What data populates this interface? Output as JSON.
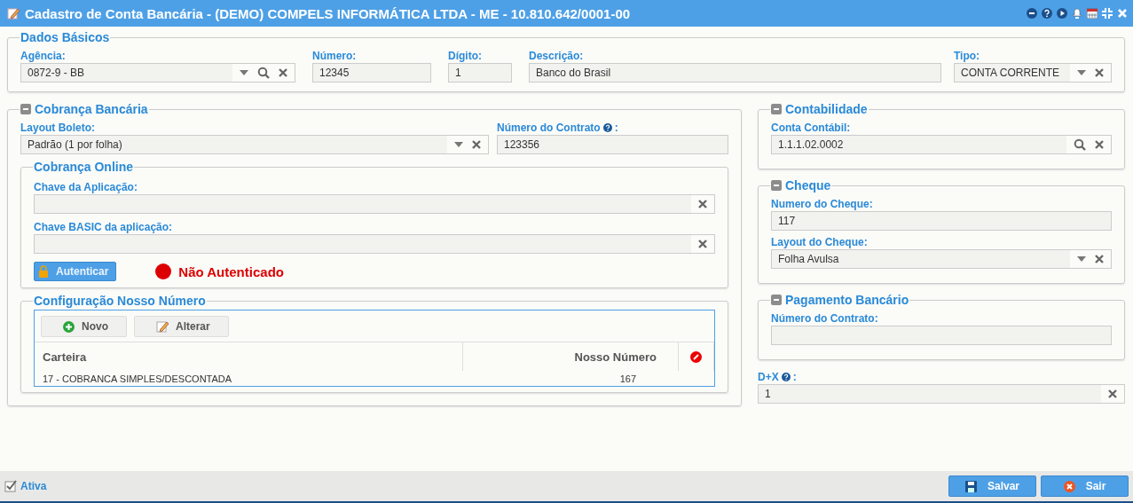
{
  "window": {
    "title": "Cadastro de Conta Bancária - (DEMO) COMPELS INFORMÁTICA LTDA - ME - 10.810.642/0001-00"
  },
  "dados_basicos": {
    "title": "Dados Básicos",
    "fields": [
      {
        "label": "Agência:",
        "value": "0872-9 - BB",
        "kind": "combo_search"
      },
      {
        "label": "Número:",
        "value": "12345",
        "kind": "plain"
      },
      {
        "label": "Dígito:",
        "value": "1",
        "kind": "plain"
      },
      {
        "label": "Descrição:",
        "value": "Banco do Brasil",
        "kind": "plain"
      },
      {
        "label": "Tipo:",
        "value": "CONTA CORRENTE",
        "kind": "combo"
      }
    ]
  },
  "cobranca_bancaria": {
    "title": "Cobrança Bancária",
    "expanded": true,
    "fields": [
      {
        "label": "Layout Boleto:",
        "value": "Padrão (1 por folha)",
        "kind": "combo"
      },
      {
        "label": "Número do Contrato",
        "suffix": ":",
        "value": "123356",
        "kind": "plain",
        "help": true
      }
    ],
    "cobranca_online": {
      "title": "Cobrança Online",
      "fields": [
        {
          "label": "Chave da Aplicação:",
          "kind": "clear"
        },
        {
          "label": "Chave BASIC da aplicação:",
          "kind": "clear"
        }
      ],
      "button": "Autenticar",
      "authenticated": false,
      "status": "Não Autenticado"
    },
    "nosso_numero": {
      "title": "Configuração Nosso Número",
      "toolbar": [
        {
          "label": "Novo",
          "kind": "add"
        },
        {
          "label": "Alterar",
          "kind": "edit"
        }
      ],
      "columns": [
        "Carteira",
        "Nosso Número"
      ],
      "rows": [
        [
          "17 - COBRANCA SIMPLES/DESCONTADA",
          "167"
        ]
      ]
    }
  },
  "contabilidade": {
    "title": "Contabilidade",
    "expanded": true,
    "fields": [
      {
        "label": "Conta Contábil:",
        "value": "1.1.1.02.0002",
        "kind": "search"
      }
    ]
  },
  "cheque": {
    "title": "Cheque",
    "expanded": true,
    "fields": [
      {
        "label": "Numero do Cheque:",
        "value": "117",
        "kind": "plain"
      },
      {
        "label": "Layout do Cheque:",
        "value": "Folha Avulsa",
        "kind": "combo"
      }
    ]
  },
  "pagamento_bancario": {
    "title": "Pagamento Bancário",
    "expanded": true,
    "fields": [
      {
        "label": "Número do Contrato:",
        "kind": "plain"
      }
    ]
  },
  "dx": {
    "label": "D+X",
    "suffix": ":",
    "value": "1",
    "kind": "clear",
    "help": true
  },
  "footer": {
    "active": {
      "label": "Ativa",
      "checked": true
    },
    "buttons": [
      {
        "label": "Salvar",
        "kind": "save"
      },
      {
        "label": "Sair",
        "kind": "exit"
      }
    ]
  }
}
